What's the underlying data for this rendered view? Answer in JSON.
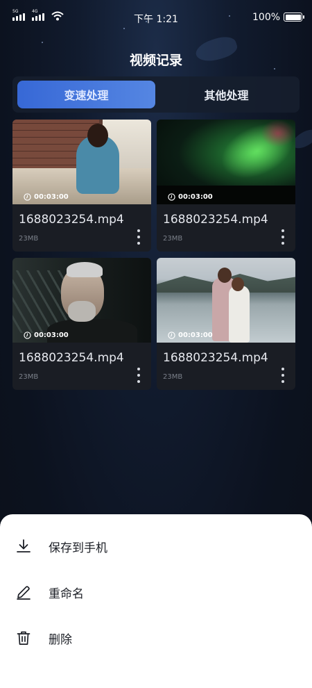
{
  "status_bar": {
    "sim1_label": "5G",
    "sim2_label": "4G",
    "time": "下午 1:21",
    "battery": "100%"
  },
  "page": {
    "title": "视频记录"
  },
  "tabs": [
    {
      "label": "变速处理",
      "active": true
    },
    {
      "label": "其他处理",
      "active": false
    }
  ],
  "videos": [
    {
      "duration": "00:03:00",
      "filename": "1688023254.mp4",
      "size": "23MB",
      "thumbnail": "woman-reading-on-sofa"
    },
    {
      "duration": "00:03:00",
      "filename": "1688023254.mp4",
      "size": "23MB",
      "thumbnail": "green-aurora-night-sky"
    },
    {
      "duration": "00:03:00",
      "filename": "1688023254.mp4",
      "size": "23MB",
      "thumbnail": "older-man-portrait"
    },
    {
      "duration": "00:03:00",
      "filename": "1688023254.mp4",
      "size": "23MB",
      "thumbnail": "couple-by-lake"
    }
  ],
  "action_sheet": {
    "items": [
      {
        "label": "保存到手机",
        "icon": "download-icon"
      },
      {
        "label": "重命名",
        "icon": "edit-icon"
      },
      {
        "label": "删除",
        "icon": "trash-icon"
      }
    ]
  },
  "colors": {
    "accent": "#3768d6",
    "background": "#0b111d",
    "card": "#1a1d24",
    "sheet": "#ffffff"
  }
}
